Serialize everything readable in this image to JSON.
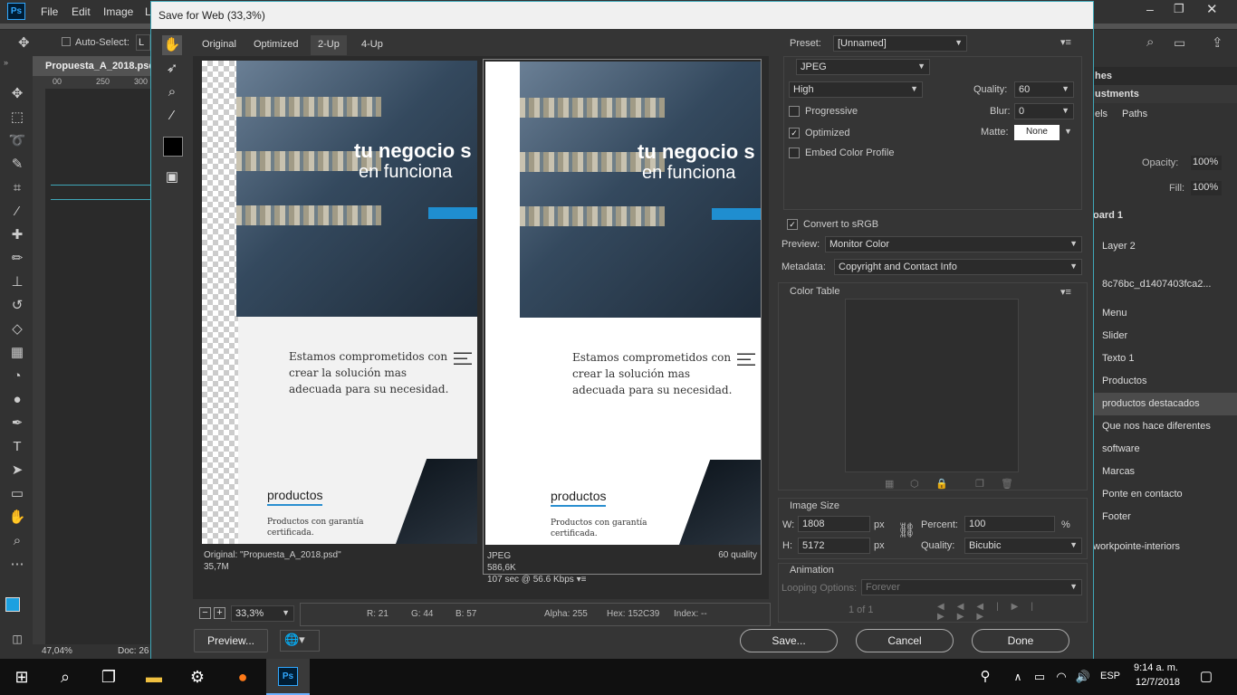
{
  "ps_menu": {
    "items": [
      "File",
      "Edit",
      "Image",
      "L"
    ]
  },
  "ps_options": {
    "auto_select": "Auto-Select:",
    "layer_dd": "L"
  },
  "ps_doc": {
    "tab": "Propuesta_A_2018.psd",
    "ruler": [
      "00",
      "250",
      "300"
    ]
  },
  "ps_status": {
    "zoom": "47,04%",
    "doc": "Doc: 26"
  },
  "ps_right": {
    "tabs": [
      "hes",
      "ustments"
    ],
    "subtabs": [
      "els",
      "Paths"
    ],
    "opacity_label": "Opacity:",
    "opacity": "100%",
    "fill_label": "Fill:",
    "fill": "100%",
    "artboard": "oard 1",
    "layers": [
      "Layer 2",
      "8c76bc_d1407403fca2...",
      "Menu",
      "Slider",
      "Texto 1",
      "Productos",
      "productos destacados",
      "Que nos hace diferentes",
      "software",
      "Marcas",
      "Ponte en contacto",
      "Footer",
      "workpointe-interiors"
    ]
  },
  "dialog": {
    "title": "Save for Web (33,3%)",
    "tabs": [
      "Original",
      "Optimized",
      "2-Up",
      "4-Up"
    ],
    "selected_tab": "2-Up",
    "left_pane": {
      "headline1": "tu negocio s",
      "headline2": "en funciona",
      "copy": "Estamos comprometidos con crear la solución mas adecuada para su necesidad.",
      "products": "productos",
      "products_sub": "Productos con garantía certificada.",
      "info1": "Original: \"Propuesta_A_2018.psd\"",
      "info2": "35,7M"
    },
    "right_pane": {
      "headline1": "tu negocio s",
      "headline2": "en funciona",
      "copy": "Estamos comprometidos con crear la solución mas adecuada para su necesidad.",
      "products": "productos",
      "products_sub": "Productos con garantía certificada.",
      "format": "JPEG",
      "size": "586,6K",
      "time": "107 sec @ 56.6 Kbps",
      "quality_label": "60 quality"
    },
    "zoom": "33,3%",
    "readout": {
      "r": "R: 21",
      "g": "G: 44",
      "b": "B: 57",
      "alpha": "Alpha: 255",
      "hex": "Hex: 152C39",
      "index": "Index: --"
    },
    "preview_btn": "Preview...",
    "save_btn": "Save...",
    "cancel_btn": "Cancel",
    "done_btn": "Done",
    "settings": {
      "preset_label": "Preset:",
      "preset": "[Unnamed]",
      "format": "JPEG",
      "compression": "High",
      "quality_label": "Quality:",
      "quality": "60",
      "blur_label": "Blur:",
      "blur": "0",
      "matte_label": "Matte:",
      "matte": "None",
      "progressive": "Progressive",
      "optimized": "Optimized",
      "embed": "Embed Color Profile",
      "convert": "Convert to sRGB",
      "preview_label": "Preview:",
      "preview": "Monitor Color",
      "metadata_label": "Metadata:",
      "metadata": "Copyright and Contact Info",
      "color_table": "Color Table",
      "image_size": "Image Size",
      "w_label": "W:",
      "w": "1808",
      "h_label": "H:",
      "h": "5172",
      "px": "px",
      "percent_label": "Percent:",
      "percent": "100",
      "pct": "%",
      "quality_rs_label": "Quality:",
      "quality_rs": "Bicubic",
      "animation": "Animation",
      "looping_label": "Looping Options:",
      "looping": "Forever",
      "frame": "1 of 1"
    },
    "checks": {
      "progressive": false,
      "optimized": true,
      "embed": false,
      "convert": true
    }
  },
  "taskbar": {
    "time": "9:14 a. m.",
    "date": "12/7/2018",
    "lang": "ESP"
  },
  "colors": {
    "accent": "#2a8fd0",
    "dialog_border": "#3fa7b8",
    "ps_blue": "#31a8ff"
  }
}
